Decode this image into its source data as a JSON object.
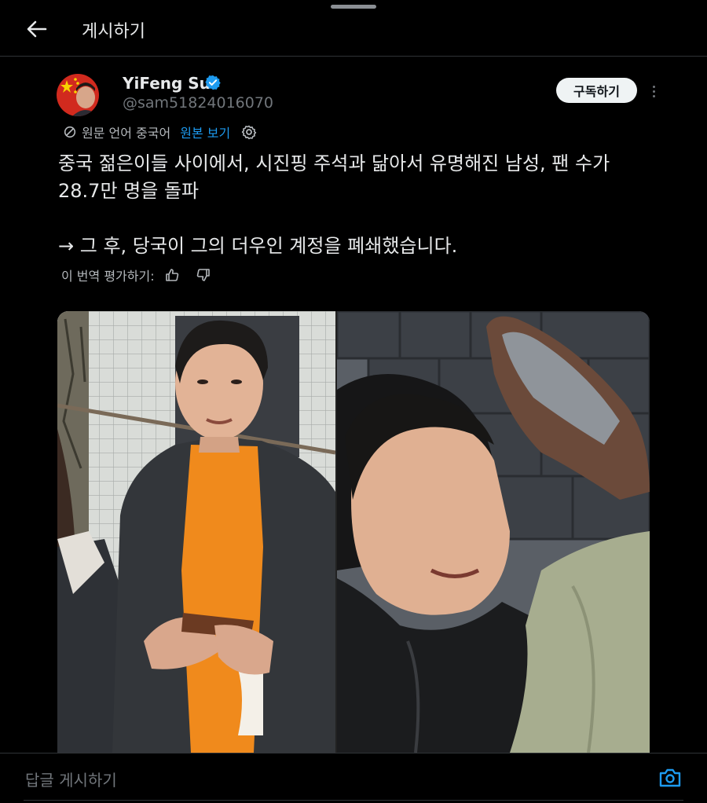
{
  "header": {
    "title": "게시하기"
  },
  "post": {
    "author": {
      "name": "YiFeng Su",
      "handle": "@sam51824016070",
      "verified": true
    },
    "subscribe_label": "구독하기",
    "translation": {
      "source_label": "원문 언어 중국어",
      "show_original_label": "원본 보기"
    },
    "text": "중국 젊은이들 사이에서, 시진핑 주석과 닮아서 유명해진 남성, 팬 수가\n28.7만 명을 돌파\n\n→ 그 후, 당국이 그의 더우인 계정을 폐쇄했습니다.",
    "rate_translation_label": "이 번역 평가하기:"
  },
  "reply": {
    "placeholder": "답글 게시하기"
  },
  "colors": {
    "background": "#000000",
    "link": "#1d9bf0",
    "verified": "#1d9bf0",
    "divider": "#2f3336"
  },
  "icons": [
    "back-arrow-icon",
    "verified-badge-icon",
    "more-icon",
    "translate-icon",
    "settings-gear-icon",
    "thumbs-up-icon",
    "thumbs-down-icon",
    "camera-icon"
  ]
}
